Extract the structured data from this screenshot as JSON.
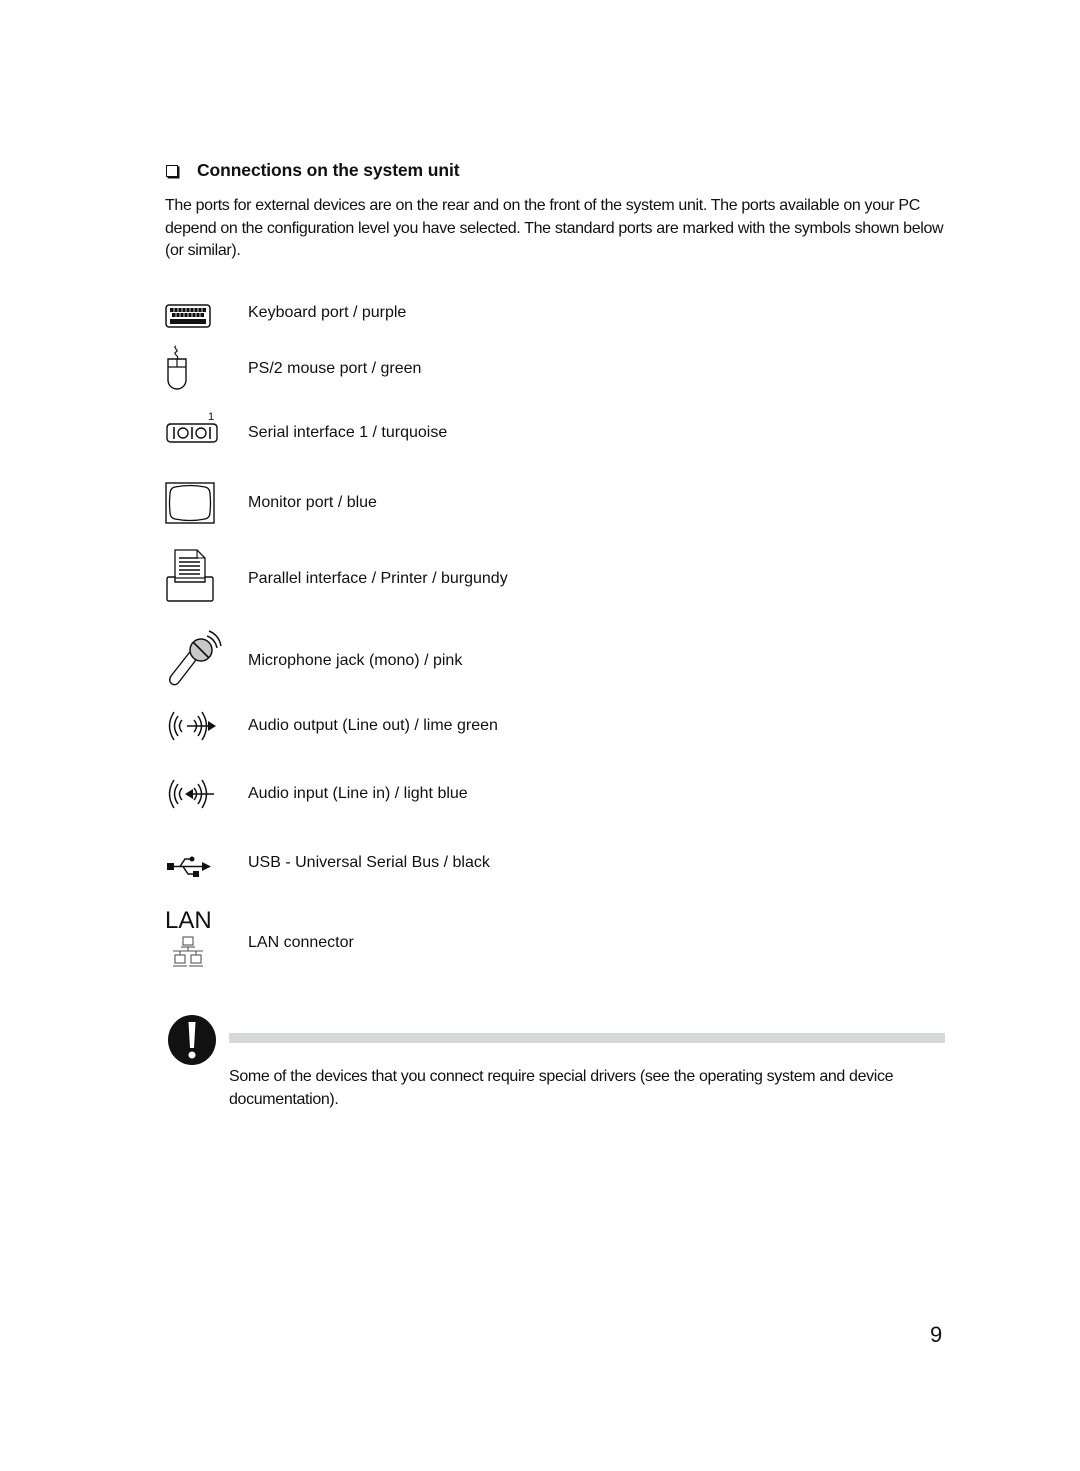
{
  "section": {
    "heading": "Connections on the system unit",
    "intro": "The ports for external devices are on the rear and on the front of the system unit. The ports available on your PC depend on the configuration level you have selected. The standard ports are marked with the symbols shown below (or similar)."
  },
  "ports": [
    {
      "icon": "keyboard-icon",
      "label": "Keyboard port / purple"
    },
    {
      "icon": "mouse-icon",
      "label": "PS/2 mouse port / green"
    },
    {
      "icon": "serial-port-icon",
      "label": "Serial interface 1 / turquoise",
      "icon_badge": "1"
    },
    {
      "icon": "monitor-icon",
      "label": "Monitor port / blue"
    },
    {
      "icon": "printer-icon",
      "label": "Parallel interface / Printer / burgundy"
    },
    {
      "icon": "microphone-icon",
      "label": "Microphone jack (mono) / pink"
    },
    {
      "icon": "audio-out-icon",
      "label": "Audio output (Line out) / lime green"
    },
    {
      "icon": "audio-in-icon",
      "label": "Audio input (Line in) / light blue"
    },
    {
      "icon": "usb-icon",
      "label": "USB - Universal Serial Bus / black"
    },
    {
      "icon": "lan-icon",
      "label": "LAN connector",
      "icon_text": "LAN"
    }
  ],
  "note": {
    "icon": "exclamation-icon",
    "text": "Some of the devices that you connect require special drivers (see the operating system and device documentation)."
  },
  "page_number": "9"
}
